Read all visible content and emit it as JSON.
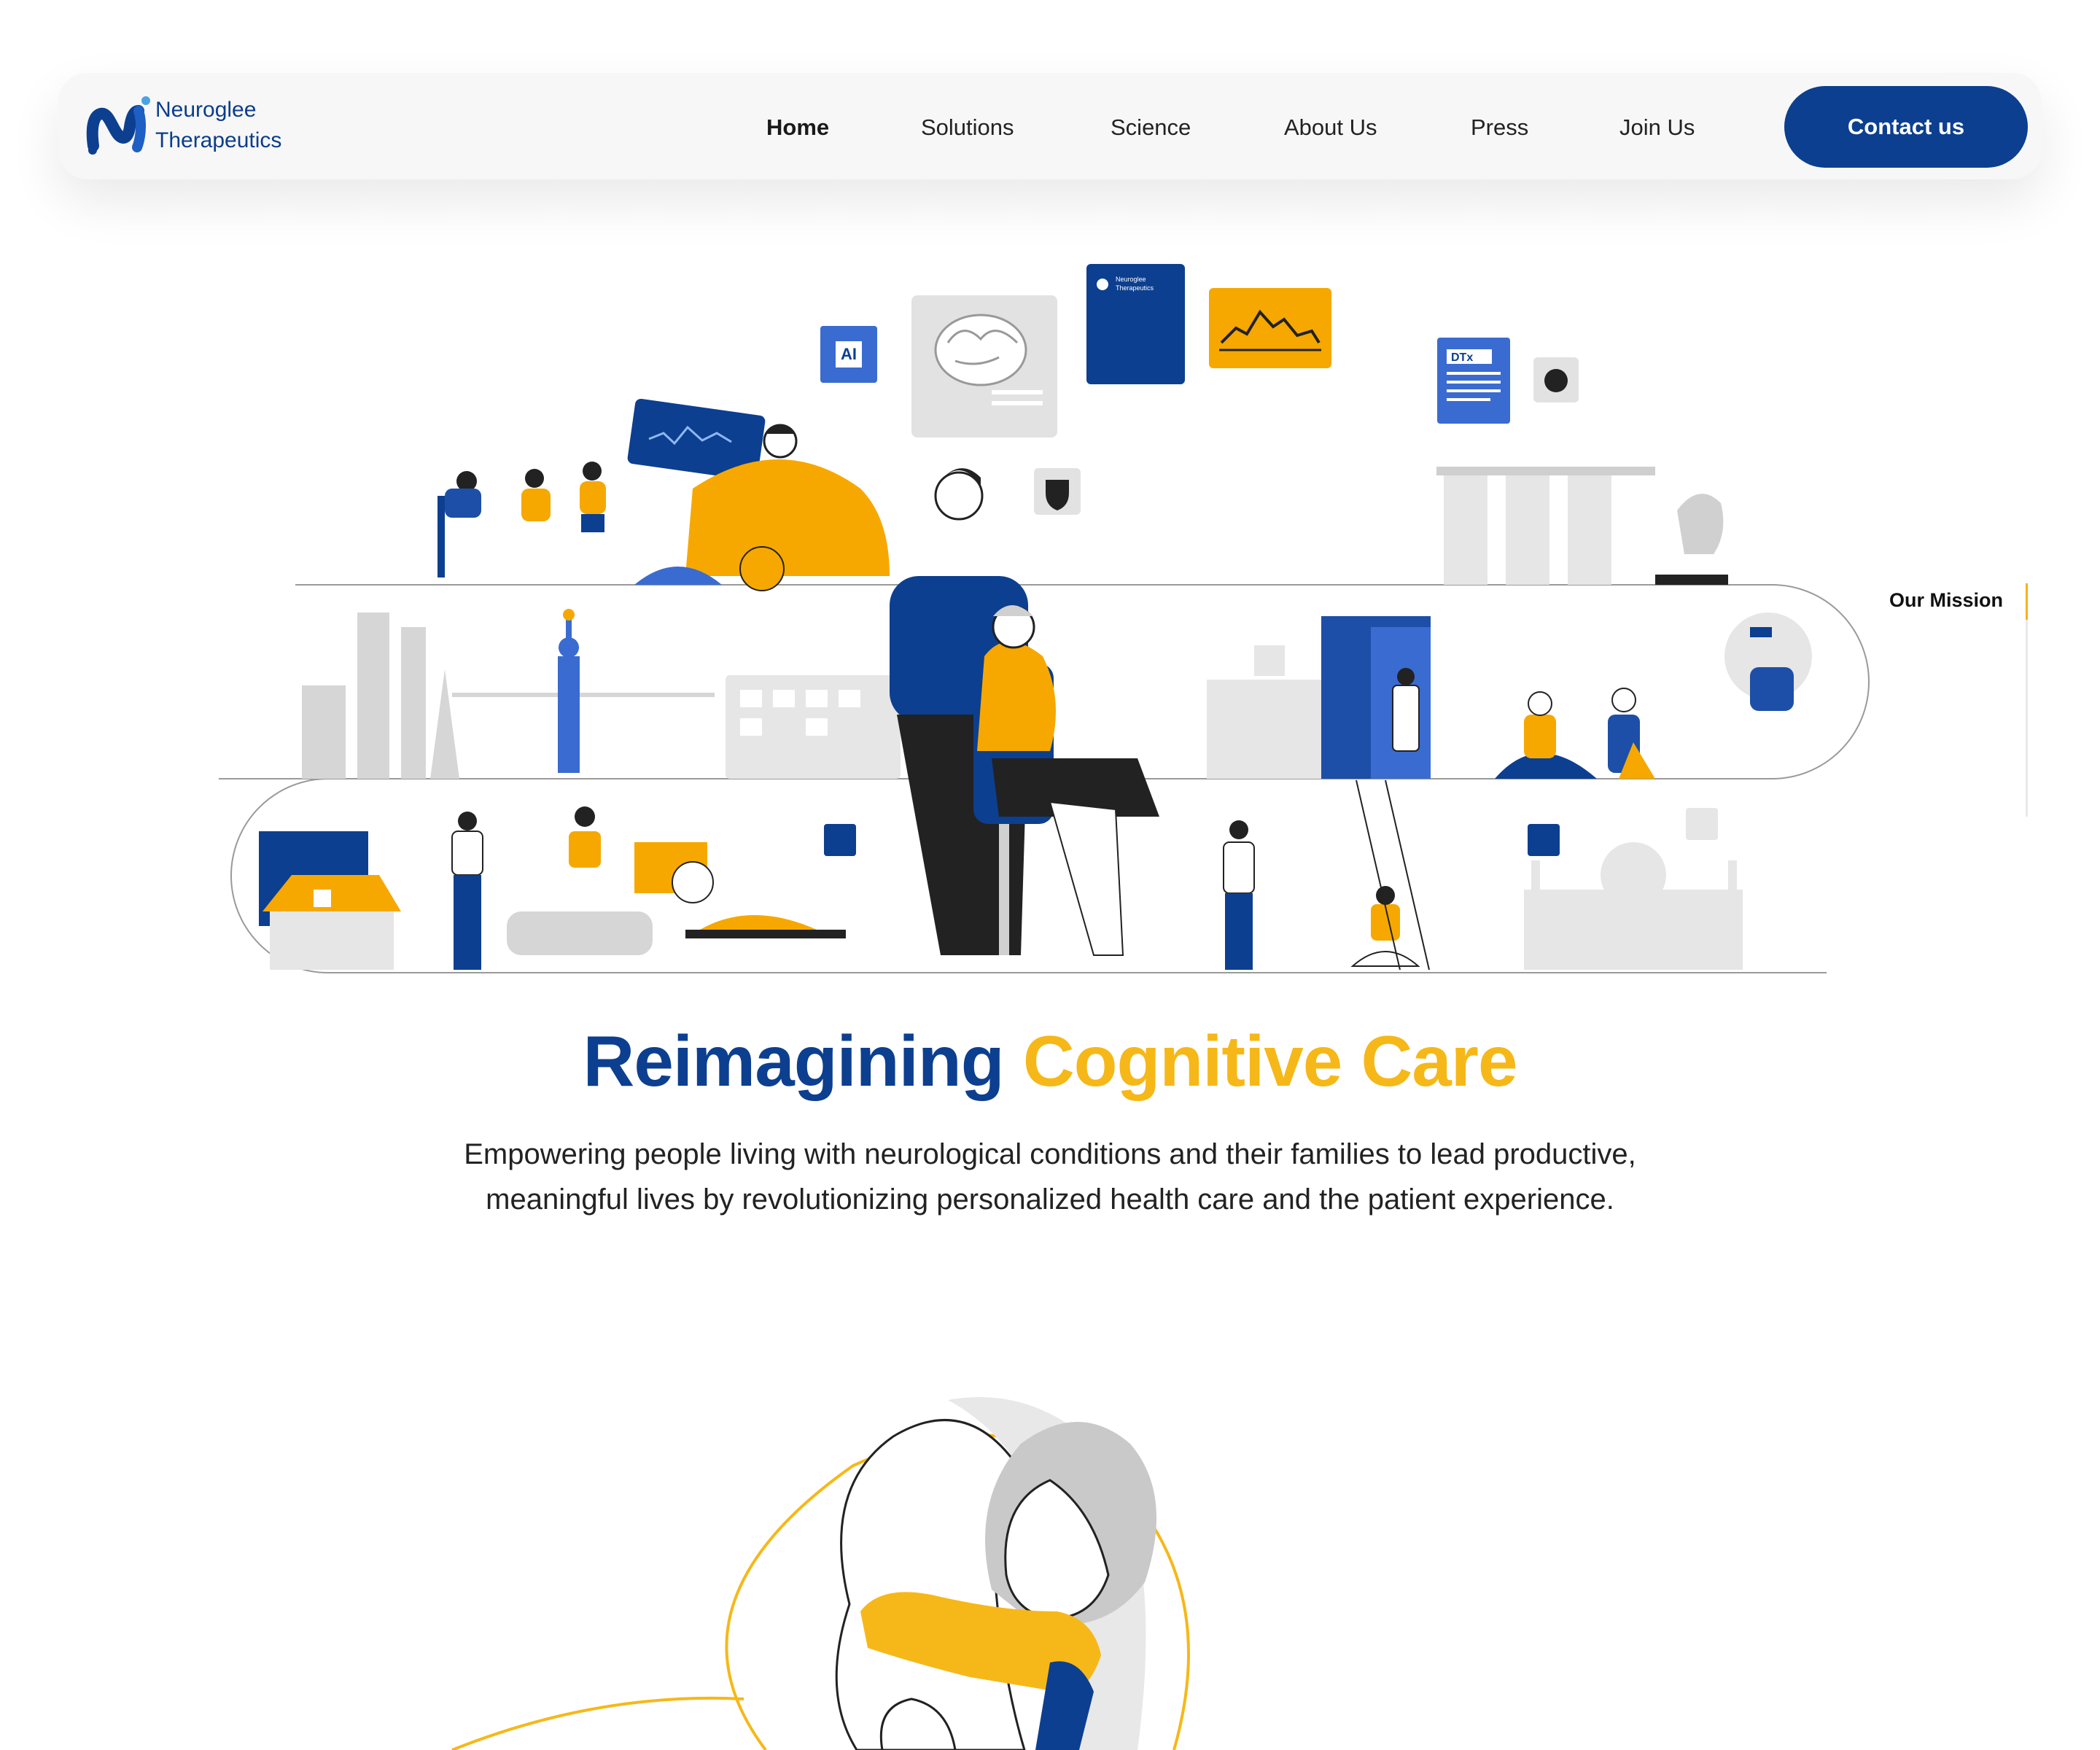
{
  "brand": {
    "name_line1": "Neuroglee",
    "name_line2": "Therapeutics"
  },
  "nav": {
    "items": [
      "Home",
      "Solutions",
      "Science",
      "About Us",
      "Press",
      "Join Us"
    ],
    "active": "Home",
    "contact_label": "Contact us"
  },
  "hero": {
    "title_part1": "Reimagining",
    "title_part2": "Cognitive Care",
    "subtitle_line1": "Empowering people living with neurological conditions and their families to lead productive,",
    "subtitle_line2": "meaningful lives by revolutionizing personalized health care and the patient experience.",
    "illustration_card_logo_line1": "Neuroglee",
    "illustration_card_logo_line2": "Therapeutics",
    "illustration_dtx_label": "DTx",
    "illustration_ai_label": "AI"
  },
  "section_nav": {
    "label": "Our Mission"
  },
  "colors": {
    "brand_blue": "#0c3f8f",
    "brand_yellow": "#f6b818",
    "light_gray": "#e6e6e6",
    "nav_bg": "#f7f7f7"
  },
  "icons": [
    "neuroglee-logo-icon",
    "brain-icon",
    "ai-chip-icon",
    "shield-icon",
    "chart-icon",
    "hospital-icon",
    "statue-of-liberty-icon",
    "taj-mahal-icon",
    "merlion-icon"
  ]
}
